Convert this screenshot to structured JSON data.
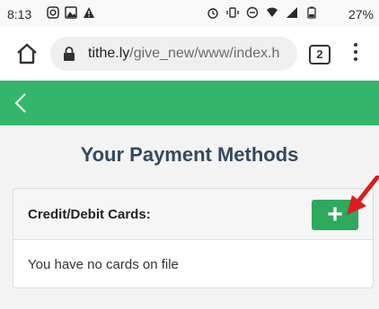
{
  "status_bar": {
    "time": "8:13",
    "battery_percent": "27%"
  },
  "browser": {
    "url_host": "tithe.ly",
    "url_path": "/give_new/www/index.h",
    "tab_count": "2"
  },
  "page": {
    "title": "Your Payment Methods"
  },
  "cards_panel": {
    "header_label": "Credit/Debit Cards:",
    "add_button_label": "+",
    "empty_message": "You have no cards on file"
  },
  "colors": {
    "header_green": "#33b56b",
    "add_button_green": "#2daa5d",
    "title_color": "#34495e",
    "arrow_red": "#e11b1b"
  },
  "icons": {
    "status_left": [
      "instagram-icon",
      "gallery-icon",
      "warning-icon"
    ],
    "status_right": [
      "alarm-icon",
      "vibrate-icon",
      "do-not-disturb-icon",
      "wifi-icon",
      "signal-icon",
      "battery-icon"
    ],
    "home": "home-icon",
    "lock": "lock-icon",
    "menu": "more-vert-icon",
    "back": "back-chevron-icon"
  }
}
